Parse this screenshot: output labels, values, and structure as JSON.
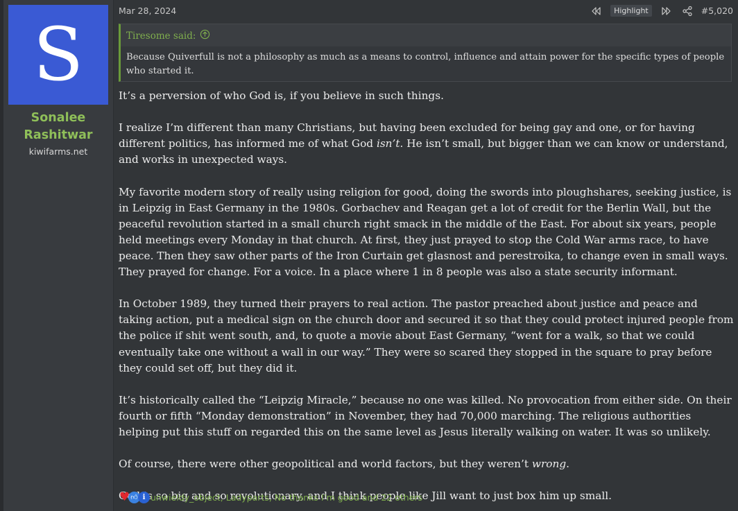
{
  "user": {
    "avatar_letter": "S",
    "name_line1": "Sonalee",
    "name_line2": "Rashitwar",
    "title": "kiwifarms.net",
    "avatar_color": "#3a5ad4",
    "name_color": "#8fbf59"
  },
  "post": {
    "date": "Mar 28, 2024",
    "highlight_label": "Highlight",
    "number": "#5,020",
    "icons": [
      "previous-icon",
      "next-icon",
      "share-icon",
      "arrow-up-circle-icon"
    ]
  },
  "quote": {
    "author": "Tiresome said:",
    "text": "Because Quiverfull is not a philosophy as much as a means to control, influence and attain power for the specific types of people who started it."
  },
  "body": {
    "p1": "It’s a perversion of who God is, if you believe in such things.",
    "p2_before": "I realize I’m different than many Christians, but having been excluded for being gay and one, or for having different politics, has informed me of what God ",
    "p2_em": "isn’t",
    "p2_after": ". He isn’t small, but bigger than we can know or understand, and works in unexpected ways.",
    "p3": "My favorite modern story of really using religion for good, doing the swords into ploughshares, seeking justice, is in Leipzig in East Germany in the 1980s. Gorbachev and Reagan get a lot of credit for the Berlin Wall, but the peaceful revolution started in a small church right smack in the middle of the East. For about six years, people held meetings every Monday in that church. At first, they just prayed to stop the Cold War arms race, to have peace. Then they saw other parts of the Iron Curtain get glasnost and perestroika, to change even in small ways. They prayed for change. For a voice. In a place where 1 in 8 people was also a state security informant.",
    "p4": "In October 1989, they turned their prayers to real action. The pastor preached about justice and peace and taking action, put a medical sign on the church door and secured it so that they could protect injured people from the police if shit went south, and, to quote a movie about East Germany, “went for a walk, so that we could eventually take one without a wall in our way.” They were so scared they stopped in the square to pray before they could set off, but they did it.",
    "p5": "It’s historically called the “Leipzig Miracle,” because no one was killed. No provocation from either side. On their fourth or fifth “Monday demonstration” in November, they had 70,000 marching. The religious authorities helping put this stuff on regarded this on the same level as Jesus literally walking on water. It was so unlikely.",
    "p6_before": "Of course, there were other geopolitical and world factors, but they weren’t ",
    "p6_em": "wrong",
    "p6_after": ".",
    "p7": "God is so big and so revolutionary, and I think people like Jill want to just box him up small."
  },
  "reactions": {
    "icons": [
      "heart-icon",
      "like-icon",
      "informative-icon"
    ],
    "text": "unwieldy_object, Ladyparts, No thanks I’m good and 22 others"
  }
}
